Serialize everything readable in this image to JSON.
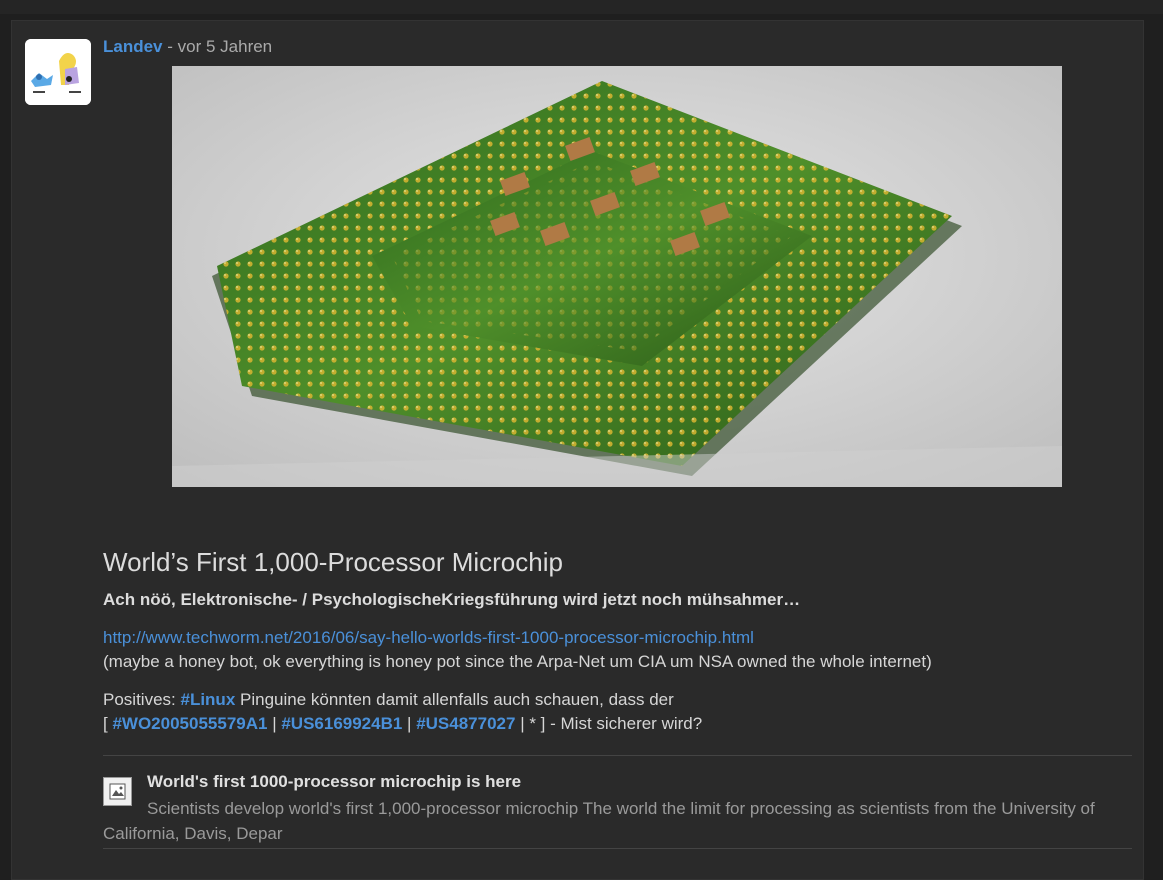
{
  "post": {
    "author": "Landev",
    "separator": " - ",
    "time": "vor 5 Jahren",
    "title": "World’s First 1,000-Processor Microchip",
    "lead": "Ach nöö, Elektronische- / PsychologischeKriegsführung wird jetzt noch mühsahmer…",
    "url": "http://www.techworm.net/2016/06/say-hello-worlds-first-1000-processor-microchip.html",
    "note": "(maybe a honey bot, ok everything is honey pot since the Arpa-Net um CIA um NSA owned the whole internet)",
    "positives_label": "Positives: ",
    "tag_linux": "#Linux",
    "positives_text": " Pinguine könnten damit allenfalls auch schauen, dass der",
    "bracket_open": "[ ",
    "tag_1": "#WO2005055579A1",
    "pipe": " | ",
    "tag_2": "#US6169924B1",
    "tag_3": "#US4877027",
    "line_end": " | * ] - Mist sicherer wird?"
  },
  "embed": {
    "title": "World's first 1000-processor microchip is here",
    "description": "Scientists develop world's first 1,000-processor microchip The world the limit for processing as scientists from the University of California, Davis, Depar"
  }
}
